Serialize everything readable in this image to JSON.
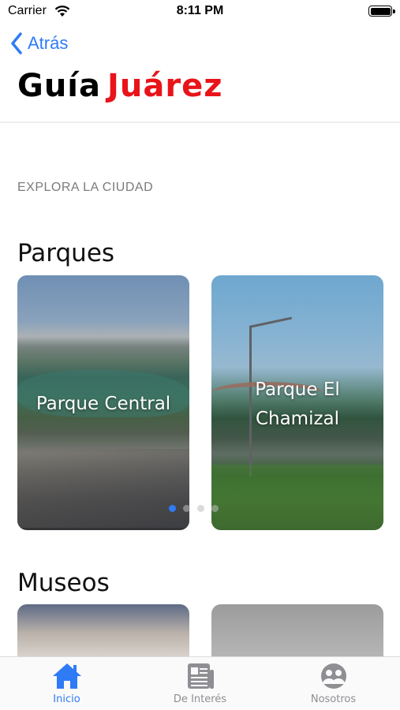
{
  "status_bar": {
    "carrier": "Carrier",
    "time": "8:11 PM"
  },
  "nav": {
    "back_label": "Atrás",
    "title_part1": "Guía",
    "title_part2": "Juárez"
  },
  "section_label": "EXPLORA LA CIUDAD",
  "categories": [
    {
      "title": "Parques",
      "cards": [
        {
          "label": "Parque Central"
        },
        {
          "label": "Parque El Chamizal"
        }
      ]
    },
    {
      "title": "Museos"
    }
  ],
  "pager": {
    "count": 4,
    "active_index": 0
  },
  "tabs": [
    {
      "label": "Inicio",
      "icon": "home-icon",
      "active": true
    },
    {
      "label": "De Interés",
      "icon": "newspaper-icon",
      "active": false
    },
    {
      "label": "Nosotros",
      "icon": "people-icon",
      "active": false
    }
  ],
  "colors": {
    "accent": "#2f7bf6",
    "title_red": "#e8141a",
    "inactive": "#8e8e93"
  }
}
